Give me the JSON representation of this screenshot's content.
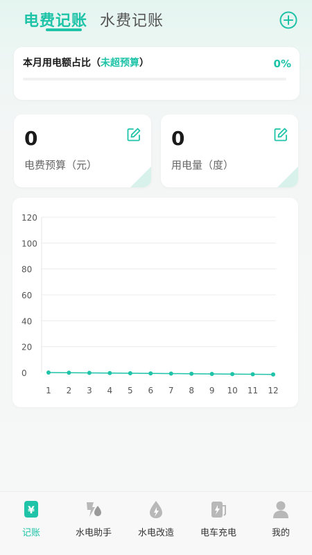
{
  "header": {
    "tabs": [
      {
        "label": "电费记账",
        "active": true
      },
      {
        "label": "水费记账",
        "active": false
      }
    ],
    "add_icon": "plus-circle-icon"
  },
  "ratio_card": {
    "title": "本月用电额占比（",
    "status": "未超预算",
    "title_end": "）",
    "value": "0%",
    "progress": 0
  },
  "stats": [
    {
      "value": "0",
      "label": "电费预算（元）",
      "icon": "edit-icon"
    },
    {
      "value": "0",
      "label": "用电量（度）",
      "icon": "edit-icon"
    }
  ],
  "chart_data": {
    "type": "line",
    "categories": [
      "1",
      "2",
      "3",
      "4",
      "5",
      "6",
      "7",
      "8",
      "9",
      "10",
      "11",
      "12"
    ],
    "series": [
      {
        "values": [
          0,
          0,
          0,
          0,
          0,
          0,
          0,
          0,
          0,
          0,
          0,
          0
        ]
      }
    ],
    "y_ticks": [
      "0",
      "20",
      "40",
      "60",
      "80",
      "100",
      "120"
    ],
    "ylim": [
      0,
      120
    ],
    "grid": true,
    "color": "#1ec3a8"
  },
  "nav": {
    "items": [
      {
        "label": "记账",
        "icon": "yuan-icon",
        "active": true
      },
      {
        "label": "水电助手",
        "icon": "tools-icon",
        "active": false
      },
      {
        "label": "水电改造",
        "icon": "water-drop-icon",
        "active": false
      },
      {
        "label": "电车充电",
        "icon": "charger-icon",
        "active": false
      },
      {
        "label": "我的",
        "icon": "user-icon",
        "active": false
      }
    ]
  },
  "colors": {
    "accent": "#1ec3a8",
    "text": "#1a1a1a",
    "muted": "#666666"
  }
}
